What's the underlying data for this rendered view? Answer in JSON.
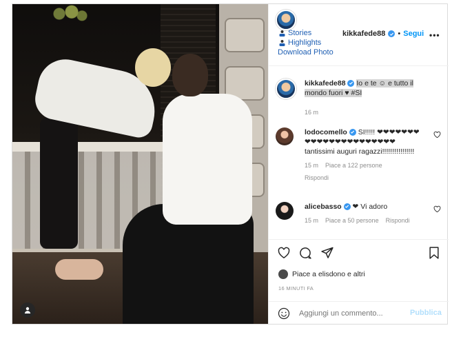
{
  "post": {
    "username": "kikkafede88",
    "follow_label": "Segui",
    "more_label": "•••",
    "extension": {
      "stories": "Stories",
      "highlights": "Highlights",
      "download": "Download Photo"
    }
  },
  "caption": {
    "username": "kikkafede88",
    "text": "Io e te ☺ e tutto il mondo fuori ♥ #SI",
    "time": "16 m"
  },
  "comments": [
    {
      "username": "lodocomello",
      "text": "SI!!!!! ❤❤❤❤❤❤❤❤❤❤❤❤❤❤❤❤❤❤❤❤❤❤ tantissimi auguri ragazzi!!!!!!!!!!!!!!!!",
      "time": "15 m",
      "likes": "Piace a 122 persone",
      "reply": "Rispondi"
    },
    {
      "username": "alicebasso",
      "text": "❤ Vi adoro",
      "time": "15 m",
      "likes": "Piace a 50 persone",
      "reply": "Rispondi"
    }
  ],
  "likes_line": "Piace a elisdono e altri",
  "posted_ago": "16 minuti fa",
  "comment_box": {
    "placeholder": "Aggiungi un commento...",
    "publish_label": "Pubblica"
  },
  "colors": {
    "link": "#0095f6",
    "verified": "#3897f0",
    "muted": "#8e8e8e"
  }
}
